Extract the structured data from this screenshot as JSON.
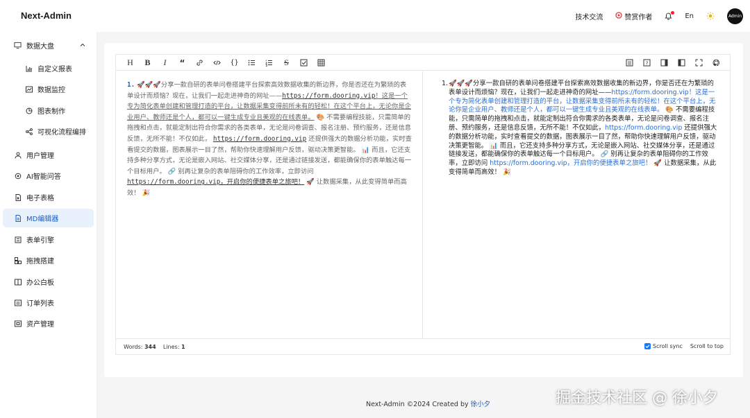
{
  "app": {
    "title": "Next-Admin"
  },
  "header": {
    "links": [
      "技术交流",
      "赞赏作者",
      "En"
    ],
    "avatar_text": "Admin"
  },
  "sidebar": {
    "items": [
      {
        "label": "数据大盘",
        "icon": "monitor-icon"
      },
      {
        "label": "自定义报表",
        "icon": "bar-chart-icon"
      },
      {
        "label": "数据监控",
        "icon": "line-chart-icon"
      },
      {
        "label": "图表制作",
        "icon": "pie-chart-icon"
      },
      {
        "label": "可视化流程编排",
        "icon": "flow-icon"
      },
      {
        "label": "用户管理",
        "icon": "user-icon"
      },
      {
        "label": "AI智能问答",
        "icon": "robot-icon"
      },
      {
        "label": "电子表格",
        "icon": "file-excel-icon"
      },
      {
        "label": "MD编辑器",
        "icon": "markdown-icon"
      },
      {
        "label": "表单引擎",
        "icon": "form-icon"
      },
      {
        "label": "拖拽搭建",
        "icon": "drag-icon"
      },
      {
        "label": "办公白板",
        "icon": "whiteboard-icon"
      },
      {
        "label": "订单列表",
        "icon": "order-icon"
      },
      {
        "label": "资产管理",
        "icon": "asset-icon"
      }
    ]
  },
  "editor": {
    "source": {
      "num": "1.",
      "emoji1": "🚀🚀🚀",
      "t1": "分享一款自研的表单问卷搭建平台探索高效数据收集的新边界，你是否还在为繁琐的表单设计而烦恼？现在，让我们一起走进神奇的网址——",
      "url1": "https://form.dooring.vip",
      "t2_ul": "！这是一个专为简化表单创建和管理打造的平台，让数据采集变得前所未有的轻松！在这个平台上，无论你是企业用户、教师还是个人，都可以一键生成专业且美观的在线表单。",
      "emoji2": "🎨",
      "t3": "不需要编程技能，只需简单的拖拽和点击，就能定制出符合你需求的各类表单，无论是问卷调查、报名注册、预约服务，还是信息反馈，无所不能！不仅如此，",
      "url2": "https://form.dooring.vip",
      "t4": "还提供强大的数据分析功能，实时查看提交的数据，图表展示一目了然，帮助你快速理解用户反馈，驱动决策更智能。",
      "emoji3": "📊",
      "t5": "而且，它还支持多种分享方式，无论是嵌入网站、社交媒体分享，还是通过链接发送，都能确保你的表单触达每一个目标用户。",
      "emoji4": "🔗",
      "t6": "别再让复杂的表单阻碍你的工作效率，立即访问",
      "url3_ul": "https://form.dooring.vip，开启你的便捷表单之旅吧！",
      "emoji5": "🚀",
      "t7": "让数据采集，从此变得简单而高效！",
      "emoji6": "🎉"
    },
    "preview": {
      "num": "1.",
      "emoji1": "🚀🚀🚀",
      "t1": "分享一款自研的表单问卷搭建平台探索高效数据收集的新边界，你是否还在为繁琐的表单设计而烦恼？现在，让我们一起走进神奇的网址——",
      "link1": "https://form.dooring.vip！这是一个专为简化表单创建和管理打造的平台，让数据采集变得前所未有的轻松！在这个平台上，无论你是企业用户、教师还是个人，都可以一键生成专业且美观的在线表单。",
      "emoji2": "🎨",
      "t2": "不需要编程技能，只需简单的拖拽和点击，就能定制出符合你需求的各类表单，无论是问卷调查、报名注册、预约服务，还是信息反馈，无所不能！不仅如此，",
      "link2": "https://form.dooring.vip",
      "t3": "还提供强大的数据分析功能，实时查看提交的数据，图表展示一目了然，帮助你快速理解用户反馈，驱动决策更智能。",
      "emoji3": "📊",
      "t4": "而且，它还支持多种分享方式，无论是嵌入网站、社交媒体分享，还是通过链接发送，都能确保你的表单触达每一个目标用户。",
      "emoji4": "🔗",
      "t5": "别再让复杂的表单阻碍你的工作效率，立即访问",
      "link3": "https://form.dooring.vip，开启你的便捷表单之旅吧！",
      "emoji5": "🚀",
      "t6": "让数据采集，从此变得简单而高效！",
      "emoji6": "🎉"
    },
    "status": {
      "words_label": "Words:",
      "words": "344",
      "lines_label": "Lines:",
      "lines": "1",
      "scroll_sync": "Scroll sync",
      "scroll_sync_checked": true,
      "scroll_top": "Scroll to top"
    }
  },
  "footer": {
    "text": "Next-Admin ©2024 Created by",
    "author": "徐小夕"
  },
  "watermark": "掘金技术社区 @ 徐小夕",
  "colors": {
    "accent": "#1677ff",
    "active_bg": "#e8f1fc",
    "link": "#2b6fd6"
  }
}
